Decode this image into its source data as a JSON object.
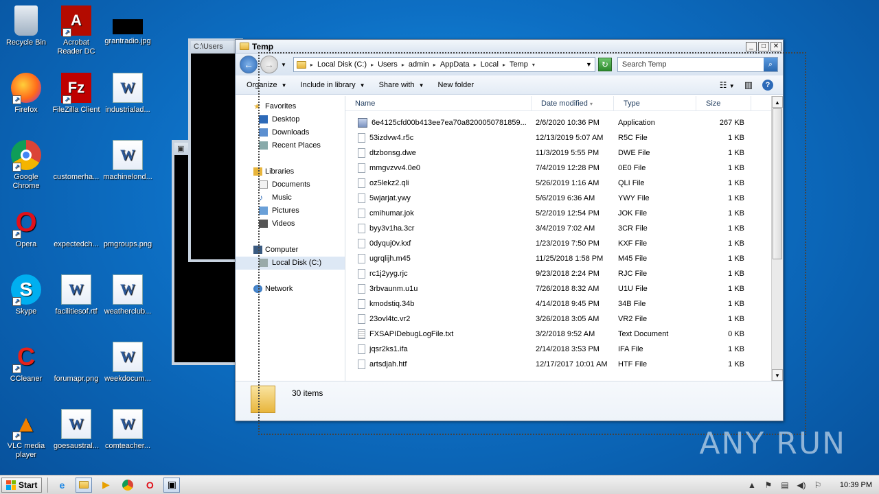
{
  "desktop": {
    "icons": [
      {
        "label": "Recycle Bin"
      },
      {
        "label": "Acrobat Reader DC"
      },
      {
        "label": "grantradio.jpg"
      },
      {
        "label": "Firefox"
      },
      {
        "label": "FileZilla Client"
      },
      {
        "label": "industrialad..."
      },
      {
        "label": "Google Chrome"
      },
      {
        "label": "customerha..."
      },
      {
        "label": "machinelond..."
      },
      {
        "label": "Opera"
      },
      {
        "label": "expectedch..."
      },
      {
        "label": "pmgroups.png"
      },
      {
        "label": "Skype"
      },
      {
        "label": "facilitiesof.rtf"
      },
      {
        "label": "weatherclub..."
      },
      {
        "label": "CCleaner"
      },
      {
        "label": "forumapr.png"
      },
      {
        "label": "weekdocum..."
      },
      {
        "label": "VLC media player"
      },
      {
        "label": "goesaustral..."
      },
      {
        "label": "comteacher..."
      }
    ],
    "watermark": "ANY RUN"
  },
  "console": {
    "title": "C:\\Users"
  },
  "explorer": {
    "title": "Temp",
    "address": {
      "crumbs": [
        "Local Disk (C:)",
        "Users",
        "admin",
        "AppData",
        "Local",
        "Temp"
      ]
    },
    "search": {
      "placeholder": "Search Temp"
    },
    "toolbar": {
      "organize": "Organize",
      "include": "Include in library",
      "share": "Share with",
      "new_folder": "New folder"
    },
    "nav": {
      "favorites": "Favorites",
      "desktop": "Desktop",
      "downloads": "Downloads",
      "recent": "Recent Places",
      "libraries": "Libraries",
      "documents": "Documents",
      "music": "Music",
      "pictures": "Pictures",
      "videos": "Videos",
      "computer": "Computer",
      "local_disk": "Local Disk (C:)",
      "network": "Network"
    },
    "columns": {
      "name": "Name",
      "date": "Date modified",
      "type": "Type",
      "size": "Size"
    },
    "files": [
      {
        "name": "6e4125cfd00b413ee7ea70a8200050781859...",
        "date": "2/6/2020 10:36 PM",
        "type": "Application",
        "size": "267 KB",
        "kind": "app"
      },
      {
        "name": "53izdvw4.r5c",
        "date": "12/13/2019 5:07 AM",
        "type": "R5C File",
        "size": "1 KB",
        "kind": "file"
      },
      {
        "name": "dtzbonsg.dwe",
        "date": "11/3/2019 5:55 PM",
        "type": "DWE File",
        "size": "1 KB",
        "kind": "file"
      },
      {
        "name": "mmgvzvv4.0e0",
        "date": "7/4/2019 12:28 PM",
        "type": "0E0 File",
        "size": "1 KB",
        "kind": "file"
      },
      {
        "name": "oz5lekz2.qli",
        "date": "5/26/2019 1:16 AM",
        "type": "QLI File",
        "size": "1 KB",
        "kind": "file"
      },
      {
        "name": "5wjarjat.ywy",
        "date": "5/6/2019 6:36 AM",
        "type": "YWY File",
        "size": "1 KB",
        "kind": "file"
      },
      {
        "name": "cmihumar.jok",
        "date": "5/2/2019 12:54 PM",
        "type": "JOK File",
        "size": "1 KB",
        "kind": "file"
      },
      {
        "name": "byy3v1ha.3cr",
        "date": "3/4/2019 7:02 AM",
        "type": "3CR File",
        "size": "1 KB",
        "kind": "file"
      },
      {
        "name": "0dyquj0v.kxf",
        "date": "1/23/2019 7:50 PM",
        "type": "KXF File",
        "size": "1 KB",
        "kind": "file"
      },
      {
        "name": "ugrqlijh.m45",
        "date": "11/25/2018 1:58 PM",
        "type": "M45 File",
        "size": "1 KB",
        "kind": "file"
      },
      {
        "name": "rc1j2yyg.rjc",
        "date": "9/23/2018 2:24 PM",
        "type": "RJC File",
        "size": "1 KB",
        "kind": "file"
      },
      {
        "name": "3rbvaunm.u1u",
        "date": "7/26/2018 8:32 AM",
        "type": "U1U File",
        "size": "1 KB",
        "kind": "file"
      },
      {
        "name": "kmodstiq.34b",
        "date": "4/14/2018 9:45 PM",
        "type": "34B File",
        "size": "1 KB",
        "kind": "file"
      },
      {
        "name": "23ovl4tc.vr2",
        "date": "3/26/2018 3:05 AM",
        "type": "VR2 File",
        "size": "1 KB",
        "kind": "file"
      },
      {
        "name": "FXSAPIDebugLogFile.txt",
        "date": "3/2/2018 9:52 AM",
        "type": "Text Document",
        "size": "0 KB",
        "kind": "txt"
      },
      {
        "name": "jqsr2ks1.ifa",
        "date": "2/14/2018 3:53 PM",
        "type": "IFA File",
        "size": "1 KB",
        "kind": "file"
      },
      {
        "name": "artsdjah.htf",
        "date": "12/17/2017 10:01 AM",
        "type": "HTF File",
        "size": "1 KB",
        "kind": "file"
      }
    ],
    "status": {
      "count": "30 items"
    }
  },
  "taskbar": {
    "start": "Start",
    "clock": "10:39 PM"
  }
}
